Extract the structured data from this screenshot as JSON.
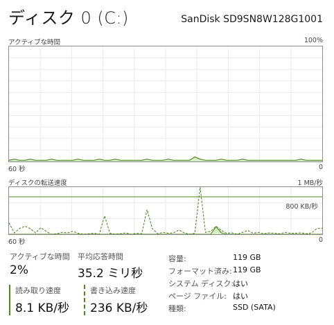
{
  "header": {
    "title": "ディスク 0 (C:)",
    "model": "SanDisk SD9SN8W128G1001"
  },
  "chart_data": [
    {
      "type": "area",
      "title": "アクティブな時間",
      "y_max_label": "100%",
      "x_left_label": "60 秒",
      "x_right_label": "0",
      "ylim": [
        0,
        100
      ],
      "series": [
        {
          "values": [
            1,
            2,
            1,
            1,
            2,
            1,
            1,
            1,
            2,
            1,
            1,
            1,
            1,
            2,
            1,
            1,
            1,
            2,
            1,
            1,
            2,
            1,
            1,
            1,
            1,
            1,
            2,
            1,
            1,
            1,
            2,
            1,
            1,
            1,
            1,
            4,
            2,
            1,
            1,
            1,
            2,
            1,
            1,
            1,
            2,
            1,
            1,
            1,
            1,
            1,
            1,
            1,
            1,
            1,
            1,
            2,
            1,
            1,
            1,
            1
          ]
        }
      ],
      "colors": {
        "line": "#4c8a1e",
        "fill": "#d7efc4"
      }
    },
    {
      "type": "line",
      "title": "ディスクの転送速度",
      "y_max_label": "1 MB/秒",
      "ref_label": "800 KB/秒",
      "x_left_label": "60 秒",
      "x_right_label": "0",
      "ylim": [
        0,
        1000
      ],
      "reference_value": 800,
      "series": [
        {
          "name": "読み取り速度",
          "style": "solid",
          "values": [
            0,
            0,
            0,
            0,
            0,
            0,
            0,
            0,
            0,
            0,
            0,
            0,
            0,
            0,
            0,
            0,
            0,
            0,
            0,
            0,
            0,
            0,
            0,
            0,
            0,
            0,
            0,
            0,
            0,
            0,
            0,
            0,
            0,
            0,
            0,
            0,
            0,
            0,
            0,
            160,
            30,
            0,
            0,
            0,
            0,
            0,
            0,
            0,
            0,
            0,
            0,
            0,
            0,
            0,
            0,
            0,
            0,
            0,
            0,
            0
          ]
        },
        {
          "name": "書き込み速度",
          "style": "dashed",
          "values": [
            240,
            30,
            120,
            170,
            120,
            30,
            140,
            60,
            0,
            10,
            40,
            30,
            60,
            20,
            0,
            10,
            20,
            0,
            390,
            20,
            0,
            10,
            30,
            0,
            20,
            10,
            520,
            120,
            10,
            40,
            20,
            30,
            90,
            30,
            0,
            20,
            1000,
            40,
            60,
            170,
            80,
            20,
            30,
            0,
            40,
            80,
            20,
            40,
            10,
            30,
            20,
            10,
            40,
            20,
            20,
            30,
            10,
            30,
            120,
            130
          ]
        }
      ],
      "colors": {
        "line": "#4c8a1e",
        "fill": "#d7efc4"
      }
    }
  ],
  "stats": {
    "active_time_label": "アクティブな時間",
    "active_time_value": "2%",
    "avg_response_label": "平均応答時間",
    "avg_response_value": "35.2 ミリ秒",
    "read_label": "読み取り速度",
    "read_value": "8.1 KB/秒",
    "write_label": "書き込み速度",
    "write_value": "236 KB/秒"
  },
  "info": [
    {
      "label": "容量:",
      "value": "119 GB"
    },
    {
      "label": "フォーマット済み:",
      "value": "119 GB"
    },
    {
      "label": "システム ディスク:",
      "value": "はい"
    },
    {
      "label": "ページ ファイル:",
      "value": "はい"
    },
    {
      "label": "種類:",
      "value": "SSD (SATA)"
    }
  ]
}
